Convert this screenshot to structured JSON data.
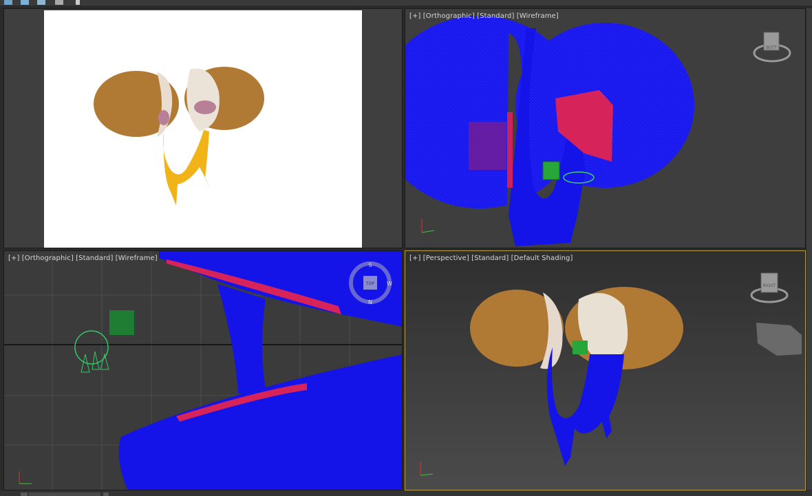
{
  "viewports": [
    {
      "id": "camera",
      "label_parts": []
    },
    {
      "id": "top-right",
      "label_parts": [
        "[+]",
        "[Orthographic]",
        "[Standard]",
        "[Wireframe]"
      ]
    },
    {
      "id": "bottom-left",
      "label_parts": [
        "[+]",
        "[Orthographic]",
        "[Standard]",
        "[Wireframe]"
      ]
    },
    {
      "id": "bottom-right",
      "label_parts": [
        "[+]",
        "[Perspective]",
        "[Standard]",
        "[Default Shading]"
      ]
    }
  ],
  "viewcube": {
    "tr_face": "BOTT",
    "br_face": "RIGHT",
    "compass": {
      "n": "N",
      "s": "S",
      "w": "W",
      "face": "TOP"
    }
  },
  "colors": {
    "wire_blue": "#1010ee",
    "wire_red": "#d6235a",
    "crust": "#b07a35",
    "yolk": "#f0b418",
    "active_border": "#b8a046",
    "helper_green": "#1e8f3a"
  },
  "icons": [
    "restore-icon",
    "move-icon",
    "scale-icon",
    "link-icon",
    "bind-icon"
  ]
}
